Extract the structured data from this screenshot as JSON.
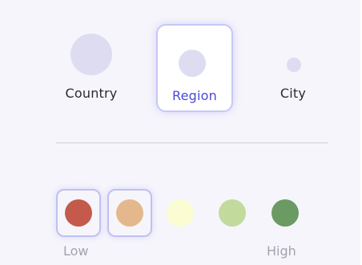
{
  "levels": [
    {
      "label": "Country",
      "selected": false,
      "dot_color": "#dedcf0",
      "icon": "large-circle-icon"
    },
    {
      "label": "Region",
      "selected": true,
      "dot_color": "#dedcf0",
      "icon": "medium-circle-icon"
    },
    {
      "label": "City",
      "selected": false,
      "dot_color": "#dedcf0",
      "icon": "small-circle-icon"
    }
  ],
  "scale": {
    "low_label": "Low",
    "high_label": "High",
    "swatches": [
      {
        "color": "#c35a4c",
        "selected": true
      },
      {
        "color": "#e4b88c",
        "selected": true
      },
      {
        "color": "#fbfcd2",
        "selected": false
      },
      {
        "color": "#c3da9d",
        "selected": false
      },
      {
        "color": "#6b9a62",
        "selected": false
      }
    ]
  },
  "colors": {
    "accent": "#4b49d4",
    "selection_border": "#c8c8f6",
    "panel_background": "#f6f5fb"
  }
}
